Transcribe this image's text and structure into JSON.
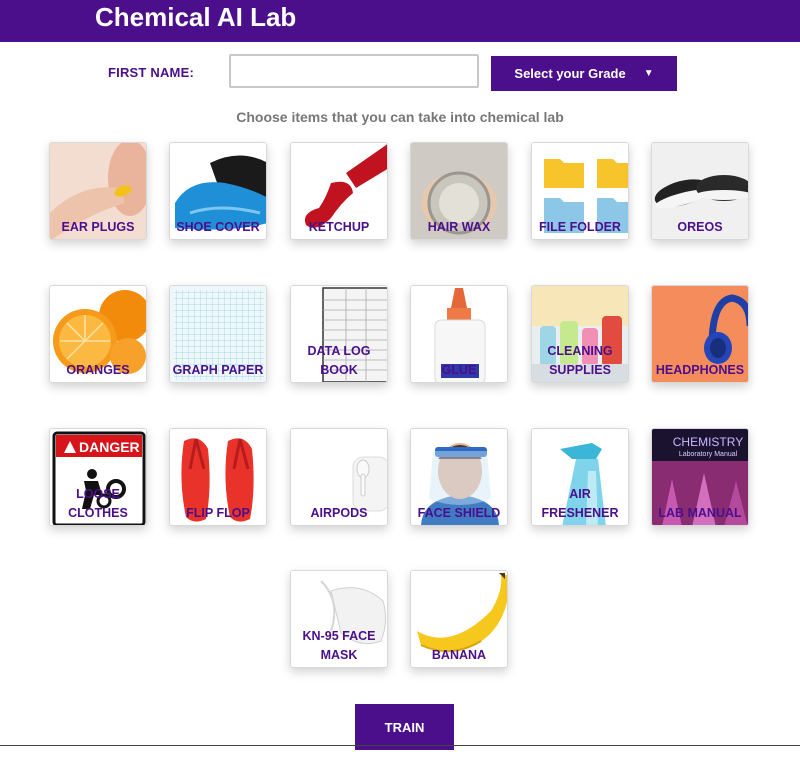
{
  "header": {
    "title": "Chemical AI Lab"
  },
  "form": {
    "first_name_label": "FIRST NAME:",
    "first_name_value": "",
    "grade_label": "Select your Grade"
  },
  "instruction": "Choose items that you can take into chemical lab",
  "items": [
    {
      "label": "EAR PLUGS",
      "icon": "ear-plug-photo"
    },
    {
      "label": "SHOE COVER",
      "icon": "shoe-cover-photo"
    },
    {
      "label": "KETCHUP",
      "icon": "ketchup-photo"
    },
    {
      "label": "HAIR WAX",
      "icon": "hair-wax-photo"
    },
    {
      "label": "FILE FOLDER",
      "icon": "folder-photo"
    },
    {
      "label": "OREOS",
      "icon": "oreo-photo"
    },
    {
      "label": "ORANGES",
      "icon": "orange-photo"
    },
    {
      "label": "GRAPH PAPER",
      "icon": "graph-paper-photo"
    },
    {
      "label": "DATA LOG BOOK",
      "icon": "log-book-photo"
    },
    {
      "label": "GLUE",
      "icon": "glue-photo"
    },
    {
      "label": "CLEANING SUPPLIES",
      "icon": "cleaning-supplies-photo"
    },
    {
      "label": "HEADPHONES",
      "icon": "headphones-photo"
    },
    {
      "label": "LOOSE CLOTHES",
      "icon": "danger-sign",
      "sign_text": "DANGER"
    },
    {
      "label": "FLIP FLOP",
      "icon": "flip-flop-photo"
    },
    {
      "label": "AIRPODS",
      "icon": "airpods-photo"
    },
    {
      "label": "FACE SHIELD",
      "icon": "face-shield-photo"
    },
    {
      "label": "AIR FRESHENER",
      "icon": "air-freshener-photo"
    },
    {
      "label": "LAB MANUAL",
      "icon": "lab-manual-photo",
      "cover_title": "CHEMISTRY",
      "cover_subtitle": "Laboratory Manual"
    },
    {
      "label": "KN-95 FACE MASK",
      "icon": "face-mask-photo"
    },
    {
      "label": "BANANA",
      "icon": "banana-photo"
    }
  ],
  "train_button": "TRAIN",
  "colors": {
    "brand": "#4b0f8c",
    "instruction": "#777777"
  }
}
